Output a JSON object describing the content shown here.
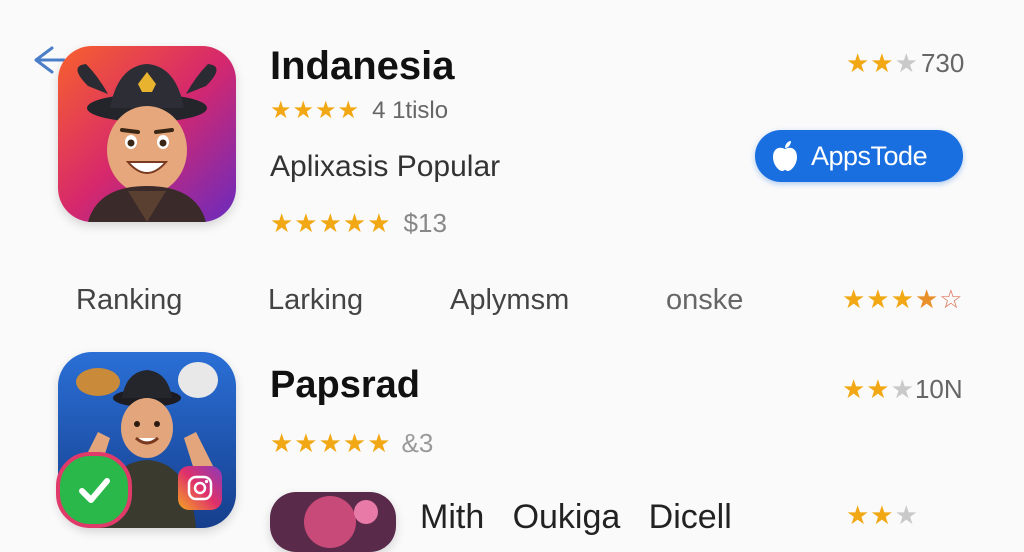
{
  "nav": {
    "back_icon": "arrow-left-icon"
  },
  "app1": {
    "title": "Indanesia",
    "rating_top": {
      "stars_filled": 2,
      "stars_total": 3,
      "count": "730"
    },
    "rating_line1": {
      "stars_filled": 4,
      "stars_total": 4,
      "text": "4 1tislo"
    },
    "subtitle": "Aplixasis Popular",
    "rating_line2": {
      "stars_filled": 5,
      "stars_total": 5,
      "text": "$13"
    },
    "store_button": {
      "label": "AppsTode",
      "icon": "apple-icon"
    }
  },
  "tabs": [
    "Ranking",
    "Larking",
    "Aplymsm",
    "onske"
  ],
  "tab_rating": {
    "stars_filled": 3.5,
    "stars_total": 5
  },
  "app2": {
    "title": "Papsrad",
    "rating_top": {
      "stars_filled": 2,
      "stars_total": 3,
      "count": "10N"
    },
    "rating_line1": {
      "stars_filled": 5,
      "stars_total": 5,
      "text": "&3"
    },
    "badges": [
      "check-icon",
      "instagram-icon"
    ]
  },
  "app3": {
    "title_partial": "Mith   Oukiga   Dicell"
  },
  "colors": {
    "accent": "#1a6fe0",
    "star": "#f2a814",
    "star_off": "#c9c9c9"
  }
}
